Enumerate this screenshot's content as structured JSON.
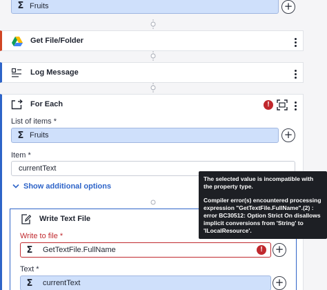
{
  "top_field": {
    "value": "Fruits"
  },
  "get_file": {
    "title": "Get File/Folder",
    "accent": "#d14524"
  },
  "log_message": {
    "title": "Log Message",
    "accent": "#2e64c8"
  },
  "for_each": {
    "title": "For Each",
    "list_label": "List of items *",
    "list_value": "Fruits",
    "item_label": "Item *",
    "item_value": "currentText",
    "show_more": "Show additional options",
    "accent": "#2e64c8"
  },
  "write_text": {
    "title": "Write Text File",
    "write_label": "Write to file *",
    "write_value": "GetTextFile.FullName",
    "text_label": "Text *",
    "text_value": "currentText",
    "error_color": "#c0282d"
  },
  "tooltip": {
    "line1": "The selected value is incompatible with the property type.",
    "line2": "Compiler error(s) encountered processing expression \"GetTextFile.FullName\".(2) : error BC30512: Option Strict On disallows implicit conversions from 'String' to 'ILocalResource'."
  },
  "icons": [
    "sigma-icon",
    "plus-circle-icon",
    "google-drive-icon",
    "log-icon",
    "loop-icon",
    "error-icon",
    "focus-icon",
    "kebab-icon",
    "edit-file-icon",
    "chevron-down-icon"
  ]
}
